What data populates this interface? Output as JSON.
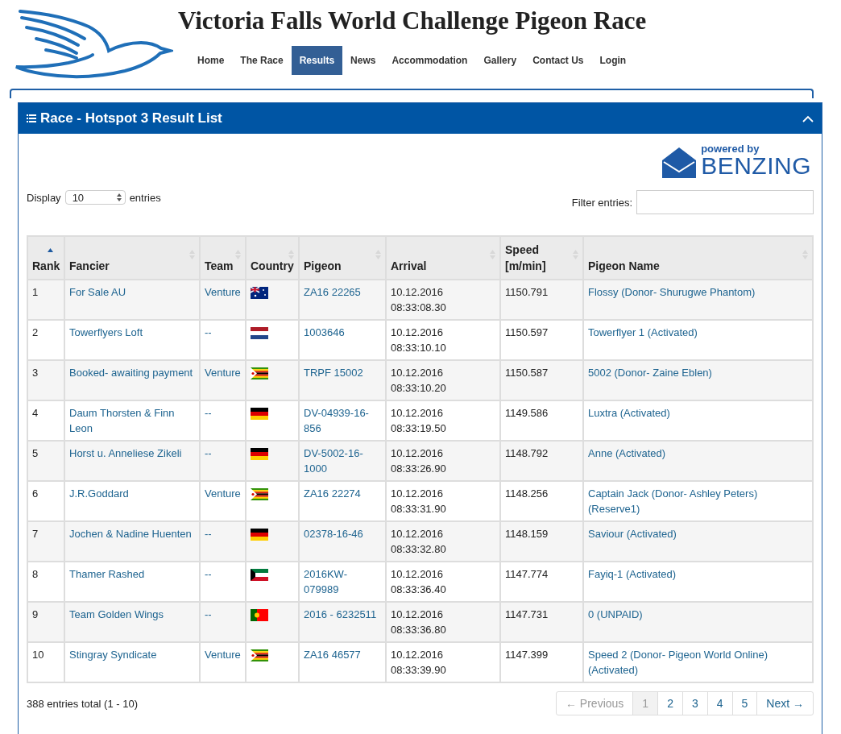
{
  "site_title": "Victoria Falls World Challenge Pigeon Race",
  "nav": [
    {
      "label": "Home",
      "selected": false
    },
    {
      "label": "The Race",
      "selected": false
    },
    {
      "label": "Results",
      "selected": true
    },
    {
      "label": "News",
      "selected": false
    },
    {
      "label": "Accommodation",
      "selected": false
    },
    {
      "label": "Gallery",
      "selected": false
    },
    {
      "label": "Contact Us",
      "selected": false
    },
    {
      "label": "Login",
      "selected": false
    }
  ],
  "panel": {
    "title": "Race - Hotspot 3 Result List",
    "expanded": true
  },
  "sponsor": {
    "tagline": "powered by",
    "name": "BENZING"
  },
  "length_menu": {
    "label_before": "Display",
    "value": "10",
    "label_after": "entries"
  },
  "filter": {
    "label": "Filter entries:"
  },
  "table": {
    "columns": [
      {
        "label": "Rank",
        "sorted": true
      },
      {
        "label": "Fancier",
        "sorted": false
      },
      {
        "label": "Team",
        "sorted": false
      },
      {
        "label": "Country",
        "sorted": false
      },
      {
        "label": "Pigeon",
        "sorted": false
      },
      {
        "label": "Arrival",
        "sorted": false
      },
      {
        "label": "Speed [m/min]",
        "sorted": false
      },
      {
        "label": "Pigeon Name",
        "sorted": false
      }
    ],
    "rows": [
      {
        "rank": "1",
        "fancier": "For Sale AU",
        "team": "Venture",
        "flag": {
          "kind": "au"
        },
        "pigeon": "ZA16 22265",
        "arrival_date": "10.12.2016",
        "arrival_time": "08:33:08.30",
        "speed": "1150.791",
        "pigeon_name": "Flossy (Donor- Shurugwe Phantom)"
      },
      {
        "rank": "2",
        "fancier": "Towerflyers Loft",
        "team": "--",
        "flag": {
          "kind": "nl"
        },
        "pigeon": "1003646",
        "arrival_date": "10.12.2016",
        "arrival_time": "08:33:10.10",
        "speed": "1150.597",
        "pigeon_name": "Towerflyer 1 (Activated)"
      },
      {
        "rank": "3",
        "fancier": "Booked- awaiting payment",
        "team": "Venture",
        "flag": {
          "kind": "zw"
        },
        "pigeon": "TRPF 15002",
        "arrival_date": "10.12.2016",
        "arrival_time": "08:33:10.20",
        "speed": "1150.587",
        "pigeon_name": "5002 (Donor- Zaine Eblen)"
      },
      {
        "rank": "4",
        "fancier": "Daum Thorsten & Finn Leon",
        "team": "--",
        "flag": {
          "kind": "de"
        },
        "pigeon": "DV-04939-16-856",
        "arrival_date": "10.12.2016",
        "arrival_time": "08:33:19.50",
        "speed": "1149.586",
        "pigeon_name": "Luxtra (Activated)"
      },
      {
        "rank": "5",
        "fancier": "Horst u. Anneliese Zikeli",
        "team": "--",
        "flag": {
          "kind": "de"
        },
        "pigeon": "DV-5002-16-1000",
        "arrival_date": "10.12.2016",
        "arrival_time": "08:33:26.90",
        "speed": "1148.792",
        "pigeon_name": "Anne (Activated)"
      },
      {
        "rank": "6",
        "fancier": "J.R.Goddard",
        "team": "Venture",
        "flag": {
          "kind": "zw"
        },
        "pigeon": "ZA16 22274",
        "arrival_date": "10.12.2016",
        "arrival_time": "08:33:31.90",
        "speed": "1148.256",
        "pigeon_name": "Captain Jack (Donor- Ashley Peters) (Reserve1)"
      },
      {
        "rank": "7",
        "fancier": "Jochen & Nadine Huenten",
        "team": "--",
        "flag": {
          "kind": "de"
        },
        "pigeon": "02378-16-46",
        "arrival_date": "10.12.2016",
        "arrival_time": "08:33:32.80",
        "speed": "1148.159",
        "pigeon_name": "Saviour (Activated)"
      },
      {
        "rank": "8",
        "fancier": "Thamer Rashed",
        "team": "--",
        "flag": {
          "kind": "kw"
        },
        "pigeon": "2016KW-079989",
        "arrival_date": "10.12.2016",
        "arrival_time": "08:33:36.40",
        "speed": "1147.774",
        "pigeon_name": "Fayiq-1 (Activated)"
      },
      {
        "rank": "9",
        "fancier": "Team Golden Wings",
        "team": "--",
        "flag": {
          "kind": "pt"
        },
        "pigeon": "2016 - 6232511",
        "arrival_date": "10.12.2016",
        "arrival_time": "08:33:36.80",
        "speed": "1147.731",
        "pigeon_name": "0 (UNPAID)"
      },
      {
        "rank": "10",
        "fancier": "Stingray Syndicate",
        "team": "Venture",
        "flag": {
          "kind": "zw"
        },
        "pigeon": "ZA16 46577",
        "arrival_date": "10.12.2016",
        "arrival_time": "08:33:39.90",
        "speed": "1147.399",
        "pigeon_name": "Speed 2 (Donor- Pigeon World Online) (Activated)"
      }
    ]
  },
  "info": "388 entries total (1 - 10)",
  "pagination": {
    "previous": {
      "label": "← Previous",
      "disabled": true
    },
    "pages": [
      {
        "label": "1",
        "selected": true
      },
      {
        "label": "2",
        "selected": false
      },
      {
        "label": "3",
        "selected": false
      },
      {
        "label": "4",
        "selected": false
      },
      {
        "label": "5",
        "selected": false
      }
    ],
    "next": {
      "label": "Next →",
      "disabled": false
    }
  }
}
